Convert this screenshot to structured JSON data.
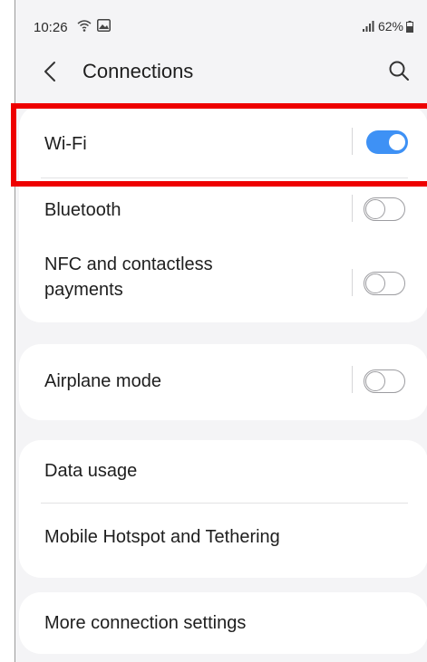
{
  "status_bar": {
    "time": "10:26",
    "battery": "62%",
    "left_icons": [
      "wifi-calling-icon",
      "gallery-notification-icon"
    ],
    "right_icons": [
      "signal-icon",
      "battery-icon"
    ]
  },
  "header": {
    "title": "Connections",
    "back_icon": "chevron-left-icon",
    "search_icon": "search-icon"
  },
  "settings": {
    "wifi": {
      "label": "Wi-Fi",
      "enabled": true
    },
    "bluetooth": {
      "label": "Bluetooth",
      "enabled": false
    },
    "nfc": {
      "label_line1": "NFC and contactless",
      "label_line2": "payments",
      "enabled": false
    },
    "airplane": {
      "label": "Airplane mode",
      "enabled": false
    },
    "data_usage": {
      "label": "Data usage"
    },
    "hotspot": {
      "label": "Mobile Hotspot and Tethering"
    },
    "more": {
      "label": "More connection settings"
    }
  },
  "colors": {
    "toggle_on": "#3e91f5",
    "highlight": "#ee0000",
    "background": "#f4f4f6"
  }
}
